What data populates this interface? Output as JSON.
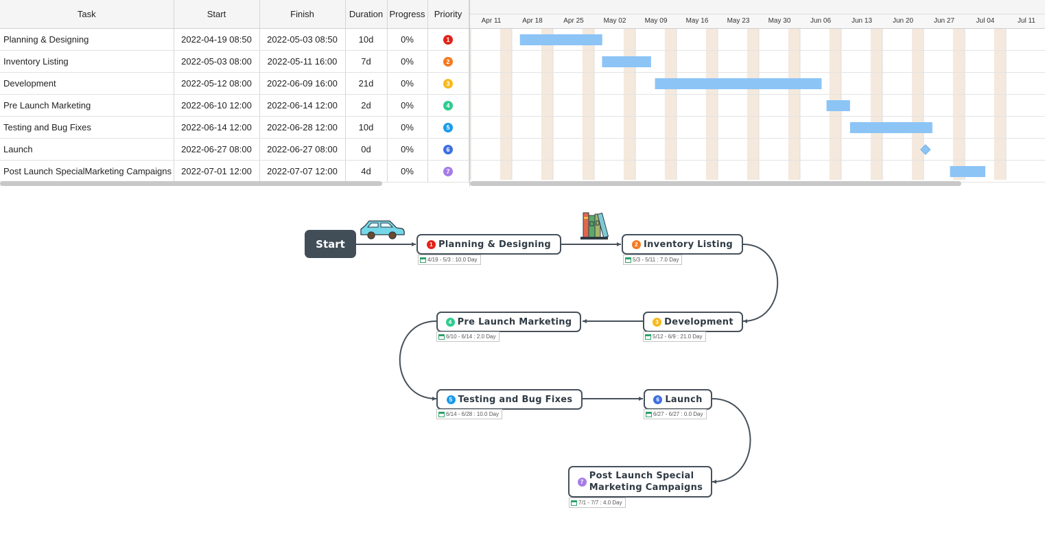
{
  "table": {
    "columns": {
      "task": "Task",
      "start": "Start",
      "finish": "Finish",
      "duration": "Duration",
      "progress": "Progress",
      "priority": "Priority"
    },
    "rows": [
      {
        "task": "Planning & Designing",
        "start": "2022-04-19 08:50",
        "finish": "2022-05-03 08:50",
        "duration": "10d",
        "progress": "0%",
        "priority": "1",
        "priority_color": "#e2231a"
      },
      {
        "task": "Inventory Listing",
        "start": "2022-05-03 08:00",
        "finish": "2022-05-11 16:00",
        "duration": "7d",
        "progress": "0%",
        "priority": "2",
        "priority_color": "#f47920"
      },
      {
        "task": "Development",
        "start": "2022-05-12 08:00",
        "finish": "2022-06-09 16:00",
        "duration": "21d",
        "progress": "0%",
        "priority": "3",
        "priority_color": "#f6b91c"
      },
      {
        "task": "Pre Launch Marketing",
        "start": "2022-06-10 12:00",
        "finish": "2022-06-14 12:00",
        "duration": "2d",
        "progress": "0%",
        "priority": "4",
        "priority_color": "#2ecc8f"
      },
      {
        "task": "Testing and Bug Fixes",
        "start": "2022-06-14 12:00",
        "finish": "2022-06-28 12:00",
        "duration": "10d",
        "progress": "0%",
        "priority": "5",
        "priority_color": "#1a9bea"
      },
      {
        "task": "Launch",
        "start": "2022-06-27 08:00",
        "finish": "2022-06-27 08:00",
        "duration": "0d",
        "progress": "0%",
        "priority": "6",
        "priority_color": "#3f6fe0"
      },
      {
        "task": "Post Launch SpecialMarketing Campaigns",
        "start": "2022-07-01 12:00",
        "finish": "2022-07-07 12:00",
        "duration": "4d",
        "progress": "0%",
        "priority": "7",
        "priority_color": "#a57de8"
      }
    ]
  },
  "gantt": {
    "weeks": [
      "Apr 11",
      "Apr 18",
      "Apr 25",
      "May 02",
      "May 09",
      "May 16",
      "May 23",
      "May 30",
      "Jun 06",
      "Jun 13",
      "Jun 20",
      "Jun 27",
      "Jul 04",
      "Jul 11"
    ],
    "first_week_monday": "2022-04-11",
    "bar_color": "#8cc4f6",
    "weekend_color": "#f4e9dc",
    "tasks": [
      {
        "start": "2022-04-19 08:50",
        "finish": "2022-05-03 08:50",
        "milestone": false
      },
      {
        "start": "2022-05-03 08:00",
        "finish": "2022-05-11 16:00",
        "milestone": false
      },
      {
        "start": "2022-05-12 08:00",
        "finish": "2022-06-09 16:00",
        "milestone": false
      },
      {
        "start": "2022-06-10 12:00",
        "finish": "2022-06-14 12:00",
        "milestone": false
      },
      {
        "start": "2022-06-14 12:00",
        "finish": "2022-06-28 12:00",
        "milestone": false
      },
      {
        "start": "2022-06-27 08:00",
        "finish": "2022-06-27 08:00",
        "milestone": true
      },
      {
        "start": "2022-07-01 12:00",
        "finish": "2022-07-07 12:00",
        "milestone": false
      }
    ]
  },
  "flow": {
    "start_label": "Start",
    "nodes": [
      {
        "label": "Planning & Designing",
        "num": "1",
        "color": "#e2231a",
        "tag": "4/19 - 5/3 : 10.0 Day"
      },
      {
        "label": "Inventory Listing",
        "num": "2",
        "color": "#f47920",
        "tag": "5/3 - 5/11 : 7.0 Day"
      },
      {
        "label": "Development",
        "num": "3",
        "color": "#f6b91c",
        "tag": "5/12 - 6/9 : 21.0 Day"
      },
      {
        "label": "Pre Launch Marketing",
        "num": "4",
        "color": "#2ecc8f",
        "tag": "6/10 - 6/14 : 2.0 Day"
      },
      {
        "label": "Testing and Bug Fixes",
        "num": "5",
        "color": "#1a9bea",
        "tag": "6/14 - 6/28 : 10.0 Day"
      },
      {
        "label": "Launch",
        "num": "6",
        "color": "#3f6fe0",
        "tag": "6/27 - 6/27 : 0.0 Day"
      },
      {
        "label": "Post Launch Special",
        "label2": "Marketing Campaigns",
        "num": "7",
        "color": "#a57de8",
        "tag": "7/1 - 7/7 : 4.0 Day"
      }
    ],
    "decorations": [
      "car-icon",
      "books-icon"
    ]
  }
}
